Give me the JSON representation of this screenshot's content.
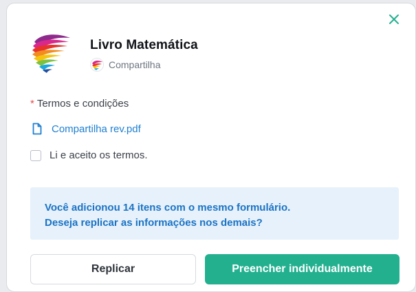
{
  "dialog": {
    "title": "Livro Matemática",
    "subtitle": "Compartilha",
    "close_icon": "close-icon"
  },
  "terms": {
    "required_marker": "*",
    "label": "Termos e condições",
    "file_name": "Compartilha rev.pdf",
    "file_icon": "document-icon",
    "accept_label": "Li e aceito os termos.",
    "accepted": false
  },
  "notice": {
    "line1": "Você adicionou 14 itens com o mesmo formulário.",
    "line2": "Deseja replicar as informações nos demais?"
  },
  "actions": {
    "secondary_label": "Replicar",
    "primary_label": "Preencher individualmente"
  },
  "colors": {
    "accent": "#23b08f",
    "link": "#1f7fd1",
    "notice_bg": "#e6f1fb",
    "notice_text": "#1b73c4",
    "required": "#e34b4b"
  }
}
